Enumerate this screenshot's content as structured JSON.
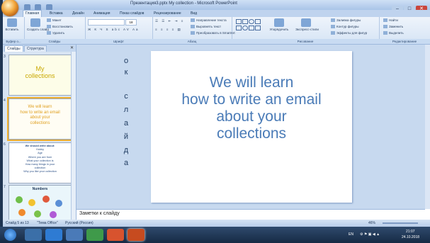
{
  "window": {
    "title": "Презентация3.pptx My collection - Microsoft PowerPoint",
    "min": "–",
    "max": "□",
    "close": "✕"
  },
  "tabs": [
    "Главная",
    "Вставка",
    "Дизайн",
    "Анимация",
    "Показ слайдов",
    "Рецензирование",
    "Вид"
  ],
  "ribbon": {
    "clipboard": {
      "paste": "Вставить",
      "cut": "Вырезать",
      "copy": "Копировать",
      "format": "Формат по образцу",
      "label": "Буфер о..."
    },
    "slides": {
      "create": "Создать слайд",
      "layout": "Макет",
      "restore": "Восстановить",
      "delete": "Удалить",
      "label": "Слайды"
    },
    "font": {
      "label": "Шрифт",
      "size": "18"
    },
    "paragraph": {
      "label": "Абзац",
      "text_dir": "Направление текста",
      "align_text": "Выровнять текст",
      "smartart": "Преобразовать в SmartArt"
    },
    "drawing": {
      "label": "Рисование",
      "arrange": "Упорядочить",
      "quick_styles": "Экспресс-стили",
      "fill": "Заливка фигуры",
      "outline": "Контур фигуры",
      "effects": "Эффекты для фигур"
    },
    "editing": {
      "label": "Редактирование",
      "find": "Найти",
      "replace": "Заменить",
      "select": "Выделить"
    }
  },
  "left_pane": {
    "tab_slides": "Слайды",
    "tab_outline": "Структура",
    "close": "✕",
    "thumbnails": [
      {
        "num": "3",
        "lines": [
          "My",
          "collections"
        ]
      },
      {
        "num": "4",
        "lines": [
          "We will learn",
          "how to write an email",
          "about your",
          "collections"
        ]
      },
      {
        "num": "6",
        "lines": [
          "We should write about:",
          "Hobby",
          "Age",
          "Where you are from",
          "What your collection is",
          "How many things in your",
          "collection",
          "Why you like your collection"
        ]
      },
      {
        "num": "7",
        "lines": [
          "Numbers"
        ]
      }
    ]
  },
  "vertical_letters": [
    "о",
    "к",
    "",
    "с",
    "л",
    "а",
    "й",
    "д",
    "а"
  ],
  "slide": {
    "lines": [
      "We will learn",
      "how to write an email",
      "about your",
      "collections"
    ],
    "text_color": "#4a7bb7"
  },
  "notes": {
    "placeholder": "Заметки к слайду"
  },
  "status": {
    "slide_info": "Слайд 5 из 13",
    "theme": "\"Тема Office\"",
    "language": "Русский (Россия)",
    "zoom": "46%"
  },
  "taskbar": {
    "lang": "EN",
    "time": "21:07",
    "date": "24.10.2018"
  }
}
